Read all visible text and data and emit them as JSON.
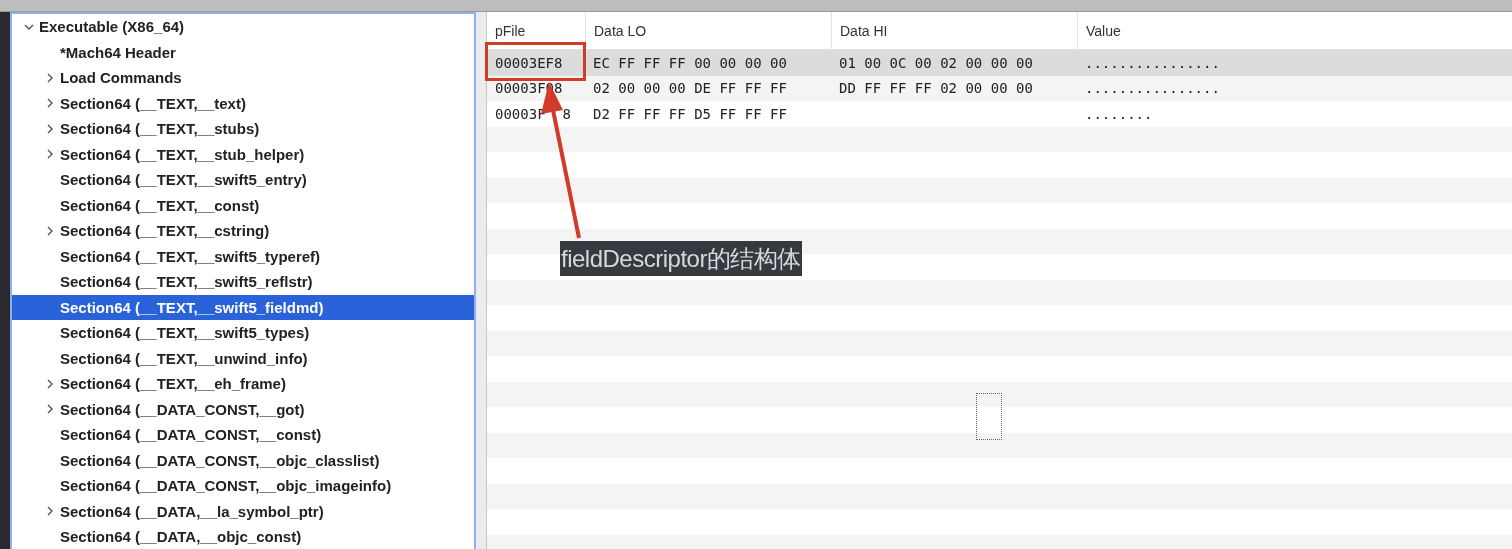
{
  "tree": {
    "label": "Executable  (X86_64)",
    "expanded": true,
    "selected": false,
    "children": [
      {
        "label": "*Mach64 Header",
        "selected": false
      },
      {
        "label": "Load Commands",
        "expanded": false,
        "selected": false
      },
      {
        "label": "Section64 (__TEXT,__text)",
        "expanded": false,
        "selected": false
      },
      {
        "label": "Section64 (__TEXT,__stubs)",
        "expanded": false,
        "selected": false
      },
      {
        "label": "Section64 (__TEXT,__stub_helper)",
        "expanded": false,
        "selected": false
      },
      {
        "label": "Section64 (__TEXT,__swift5_entry)",
        "selected": false
      },
      {
        "label": "Section64 (__TEXT,__const)",
        "selected": false
      },
      {
        "label": "Section64 (__TEXT,__cstring)",
        "expanded": false,
        "selected": false
      },
      {
        "label": "Section64 (__TEXT,__swift5_typeref)",
        "selected": false
      },
      {
        "label": "Section64 (__TEXT,__swift5_reflstr)",
        "selected": false
      },
      {
        "label": "Section64 (__TEXT,__swift5_fieldmd)",
        "selected": true
      },
      {
        "label": "Section64 (__TEXT,__swift5_types)",
        "selected": false
      },
      {
        "label": "Section64 (__TEXT,__unwind_info)",
        "selected": false
      },
      {
        "label": "Section64 (__TEXT,__eh_frame)",
        "expanded": false,
        "selected": false
      },
      {
        "label": "Section64 (__DATA_CONST,__got)",
        "expanded": false,
        "selected": false
      },
      {
        "label": "Section64 (__DATA_CONST,__const)",
        "selected": false
      },
      {
        "label": "Section64 (__DATA_CONST,__objc_classlist)",
        "selected": false
      },
      {
        "label": "Section64 (__DATA_CONST,__objc_imageinfo)",
        "selected": false
      },
      {
        "label": "Section64 (__DATA,__la_symbol_ptr)",
        "expanded": false,
        "selected": false
      },
      {
        "label": "Section64 (__DATA,__objc_const)",
        "selected": false
      }
    ]
  },
  "table": {
    "columns": [
      "pFile",
      "Data LO",
      "Data HI",
      "Value"
    ],
    "rows": [
      {
        "cells": [
          "00003EF8",
          "EC FF FF FF 00 00 00 00",
          "01 00 0C 00 02 00 00 00",
          "................"
        ],
        "selected": true
      },
      {
        "cells": [
          "00003F08",
          "02 00 00 00 DE FF FF FF",
          "DD FF FF FF 02 00 00 00",
          "................"
        ],
        "selected": false
      },
      {
        "cells": [
          {
            "text": "00003F",
            "tail": "8"
          },
          "D2 FF FF FF D5 FF FF FF",
          null,
          "........"
        ],
        "selected": false
      }
    ]
  },
  "annotation": {
    "label": "fieldDescriptor的结构体"
  }
}
